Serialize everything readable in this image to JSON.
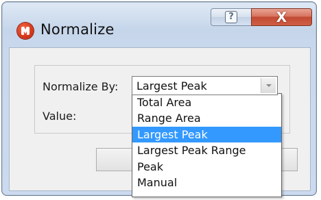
{
  "window": {
    "title": "Normalize",
    "help_glyph": "?",
    "close_glyph": "X",
    "icon": "app-logo-icon"
  },
  "form": {
    "normalize_by_label": "Normalize By:",
    "value_label": "Value:",
    "normalize_by_selected": "Largest Peak"
  },
  "dropdown": {
    "options": [
      "Total Area",
      "Range Area",
      "Largest Peak",
      "Largest Peak Range",
      "Peak",
      "Manual"
    ],
    "highlighted_index": 2
  },
  "colors": {
    "selection": "#3399ff",
    "close_button": "#c24a33",
    "title_bar": "#c6d6ea"
  }
}
